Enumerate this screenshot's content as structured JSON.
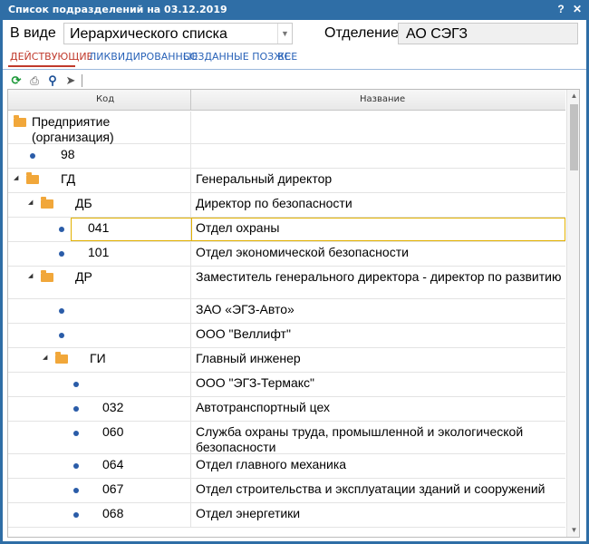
{
  "window": {
    "title": "Список подразделений на 03.12.2019",
    "help_label": "?",
    "close_label": "✕"
  },
  "filters": {
    "view_label": "В виде",
    "view_value": "Иерархического списка",
    "dept_label": "Отделение",
    "dept_value": "АО СЭГЗ"
  },
  "tabs": [
    {
      "label": "ДЕЙСТВУЮЩИЕ",
      "active": true
    },
    {
      "label": "ЛИКВИДИРОВАННЫЕ",
      "active": false
    },
    {
      "label": "СОЗДАННЫЕ ПОЗЖЕ",
      "active": false
    },
    {
      "label": "ВСЕ",
      "active": false
    }
  ],
  "toolbar": {
    "icons": [
      "refresh-icon",
      "print-icon",
      "search-icon",
      "cursor-icon"
    ]
  },
  "grid": {
    "columns": {
      "code": "Код",
      "name": "Название"
    },
    "rows": [
      {
        "code": "Предприятие (организация)",
        "name": "",
        "type": "folder-root"
      },
      {
        "code": "98",
        "name": "",
        "type": "leaf"
      },
      {
        "code": "ГД",
        "name": "Генеральный директор",
        "type": "folder"
      },
      {
        "code": "ДБ",
        "name": "Директор по безопасности",
        "type": "folder"
      },
      {
        "code": "041",
        "name": "Отдел охраны",
        "type": "leaf",
        "selected": true
      },
      {
        "code": "101",
        "name": "Отдел экономической безопасности",
        "type": "leaf"
      },
      {
        "code": "ДР",
        "name": "Заместитель генерального директора - директор по развитию",
        "type": "folder"
      },
      {
        "code": "",
        "name": "ЗАО «ЭГЗ-Авто»",
        "type": "leaf"
      },
      {
        "code": "",
        "name": "ООО \"Веллифт\"",
        "type": "leaf"
      },
      {
        "code": "ГИ",
        "name": "Главный инженер",
        "type": "folder"
      },
      {
        "code": "",
        "name": "ООО \"ЭГЗ-Термакс\"",
        "type": "leaf"
      },
      {
        "code": "032",
        "name": "Автотранспортный цех",
        "type": "leaf"
      },
      {
        "code": "060",
        "name": "Служба охраны труда, промышленной и экологической безопасности",
        "type": "leaf"
      },
      {
        "code": "064",
        "name": "Отдел главного механика",
        "type": "leaf"
      },
      {
        "code": "067",
        "name": "Отдел строительства и эксплуатации зданий и сооружений",
        "type": "leaf"
      },
      {
        "code": "068",
        "name": "Отдел энергетики",
        "type": "leaf"
      }
    ]
  }
}
